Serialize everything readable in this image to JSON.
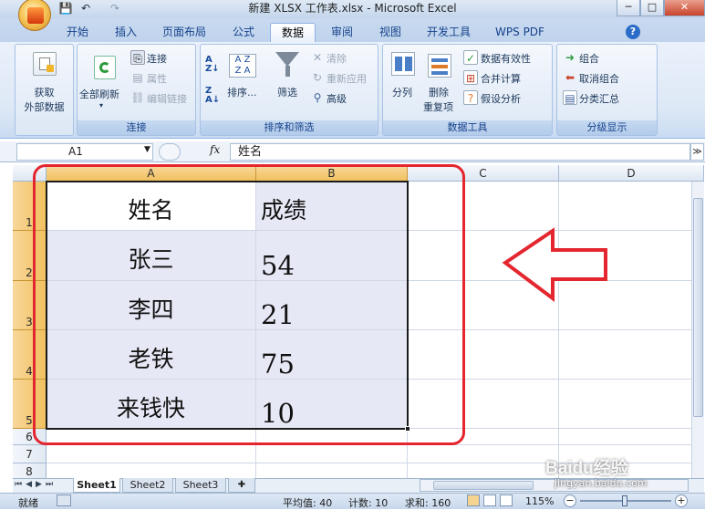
{
  "window": {
    "title": "新建 XLSX 工作表.xlsx - Microsoft Excel",
    "controls": {
      "minimize": "─",
      "maximize": "□",
      "close": "✕"
    }
  },
  "quick_access": {
    "save": "💾",
    "undo": "↶",
    "redo": "↷"
  },
  "ribbon_tabs": [
    "开始",
    "插入",
    "页面布局",
    "公式",
    "数据",
    "审阅",
    "视图",
    "开发工具",
    "WPS PDF"
  ],
  "active_tab": "数据",
  "help_icon": "?",
  "ribbon": {
    "get_data": {
      "line1": "获取",
      "line2": "外部数据"
    },
    "connections": {
      "label": "连接",
      "refresh_all": "全部刷新",
      "connections": "连接",
      "properties": "属性",
      "edit_links": "编辑链接"
    },
    "sort_filter": {
      "label": "排序和筛选",
      "sort": "排序...",
      "filter": "筛选",
      "clear": "清除",
      "reapply": "重新应用",
      "advanced": "高级"
    },
    "data_tools": {
      "label": "数据工具",
      "text_to_columns": "分列",
      "remove_dup_line1": "删除",
      "remove_dup_line2": "重复项",
      "validation": "数据有效性",
      "consolidate": "合并计算",
      "what_if": "假设分析"
    },
    "outline": {
      "label": "分级显示",
      "group": "组合",
      "ungroup": "取消组合",
      "subtotal": "分类汇总"
    }
  },
  "formula_bar": {
    "name_box": "A1",
    "fx": "fx",
    "content": "姓名"
  },
  "columns": [
    "A",
    "B",
    "C",
    "D"
  ],
  "rows": [
    "1",
    "2",
    "3",
    "4",
    "5",
    "6",
    "7",
    "8"
  ],
  "table": {
    "header": [
      "姓名",
      "成绩"
    ],
    "data": [
      [
        "张三",
        "54"
      ],
      [
        "李四",
        "21"
      ],
      [
        "老铁",
        "75"
      ],
      [
        "来钱快",
        "10"
      ]
    ]
  },
  "sheets": [
    "Sheet1",
    "Sheet2",
    "Sheet3"
  ],
  "active_sheet": "Sheet1",
  "status": {
    "ready": "就绪",
    "average": "平均值: 40",
    "count": "计数: 10",
    "sum": "求和: 160",
    "zoom": "115%"
  },
  "watermark": "Baidu经验",
  "watermark_url": "jingyan.baidu.com",
  "colors": {
    "annotation": "#e4262f",
    "selected_header": "#f1c15f",
    "band": "#e7e8f5"
  }
}
